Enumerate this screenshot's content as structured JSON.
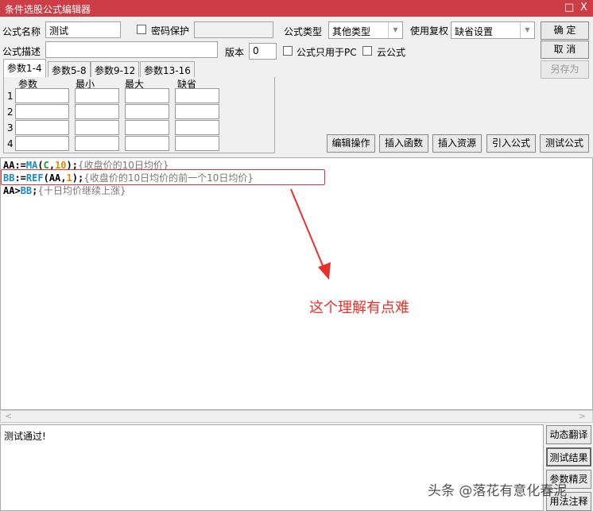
{
  "window": {
    "title": "条件选股公式编辑器",
    "maximize_icon": "□",
    "close_icon": "X"
  },
  "form": {
    "name_label": "公式名称",
    "name_value": "测试",
    "password_label": "密码保护",
    "desc_label": "公式描述",
    "desc_value": "",
    "version_label": "版本",
    "version_value": "0",
    "type_label": "公式类型",
    "type_value": "其他类型",
    "rights_label": "使用复权",
    "rights_value": "缺省设置",
    "pc_only_label": "公式只用于PC",
    "cloud_label": "云公式"
  },
  "buttons": {
    "ok": "确 定",
    "cancel": "取 消",
    "save_as": "另存为",
    "edit_op": "编辑操作",
    "insert_func": "插入函数",
    "insert_res": "插入资源",
    "import": "引入公式",
    "test": "测试公式"
  },
  "tabs": [
    "参数1-4",
    "参数5-8",
    "参数9-12",
    "参数13-16"
  ],
  "params": {
    "headers": [
      "参数",
      "最小",
      "最大",
      "缺省"
    ],
    "rows": [
      "1",
      "2",
      "3",
      "4"
    ]
  },
  "code": {
    "line1": {
      "a": "AA:=",
      "b": "MA",
      "c": "(",
      "d": "C",
      ",": ",",
      "e": "10",
      "f": ");",
      "cm": "{收盘价的10日均价}"
    },
    "line2": {
      "a": "BB",
      "b": ":=",
      "c": "REF",
      "d": "(AA,",
      "e": "1",
      "f": ");",
      "cm": "{收盘价的10日均价的前一个10日均价}"
    },
    "line3": {
      "a": "AA>",
      "b": "BB",
      "c": ";",
      "cm": "{十日均价继续上涨}"
    }
  },
  "annotation": {
    "text": "这个理解有点难",
    "color": "#e8302a"
  },
  "output": {
    "text": "测试通过!"
  },
  "side_buttons": [
    "动态翻译",
    "测试结果",
    "参数精灵",
    "用法注释"
  ],
  "watermark": "头条 @落花有意化春泥"
}
